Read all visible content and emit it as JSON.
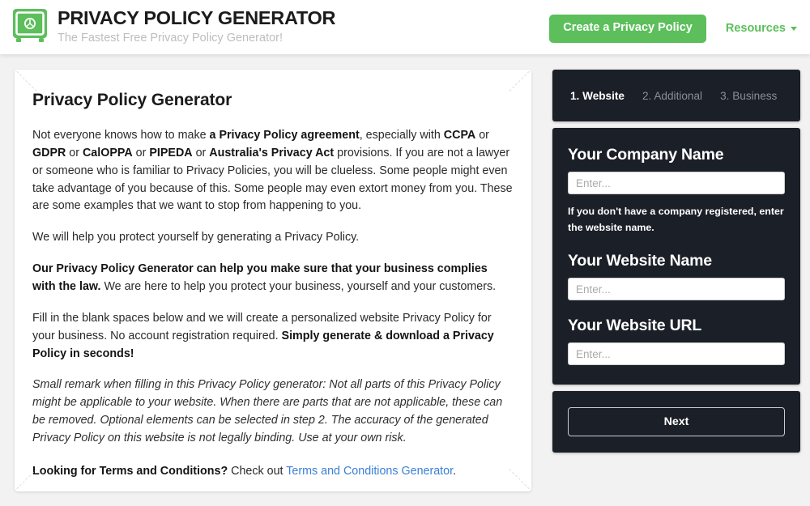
{
  "header": {
    "brand_title": "PRIVACY POLICY GENERATOR",
    "brand_tagline": "The Fastest Free Privacy Policy Generator!",
    "logo_icon": "safe-vault-icon",
    "cta_label": "Create a Privacy Policy",
    "nav_link_label": "Resources",
    "nav_caret_icon": "chevron-down-icon",
    "brand_color": "#5cbf5c"
  },
  "main": {
    "heading": "Privacy Policy Generator",
    "p1": {
      "a": "Not everyone knows how to make ",
      "b1": "a Privacy Policy agreement",
      "c": ", especially with ",
      "b2": "CCPA",
      "d": " or ",
      "b3": "GDPR",
      "e": " or ",
      "b4": "CalOPPA",
      "f": " or ",
      "b5": "PIPEDA",
      "g": " or ",
      "b6": "Australia's Privacy Act",
      "h": " provisions. If you are not a lawyer or someone who is familiar to Privacy Policies, you will be clueless. Some people might even take advantage of you because of this. Some people may even extort money from you. These are some examples that we want to stop from happening to you."
    },
    "p2": "We will help you protect yourself by generating a Privacy Policy.",
    "p3": {
      "bold": "Our Privacy Policy Generator can help you make sure that your business complies with the law.",
      "rest": " We are here to help you protect your business, yourself and your customers."
    },
    "p4": {
      "a": "Fill in the blank spaces below and we will create a personalized website Privacy Policy for your business. No account registration required. ",
      "bold": "Simply generate & download a Privacy Policy in seconds!"
    },
    "p5": "Small remark when filling in this Privacy Policy generator: Not all parts of this Privacy Policy might be applicable to your website. When there are parts that are not applicable, these can be removed. Optional elements can be selected in step 2. The accuracy of the generated Privacy Policy on this website is not legally binding. Use at your own risk.",
    "p6": {
      "bold": "Looking for Terms and Conditions?",
      "mid": " Check out ",
      "link": "Terms and Conditions Generator",
      "end": "."
    },
    "link_color": "#3a7fd5"
  },
  "wizard": {
    "tabs": [
      {
        "label": "1. Website",
        "active": true
      },
      {
        "label": "2. Additional",
        "active": false
      },
      {
        "label": "3. Business",
        "active": false
      }
    ],
    "fields": [
      {
        "label": "Your Company Name",
        "value": "",
        "placeholder": "Enter...",
        "hint": "If you don't have a company registered, enter the website name."
      },
      {
        "label": "Your Website Name",
        "value": "",
        "placeholder": "Enter...",
        "hint": ""
      },
      {
        "label": "Your Website URL",
        "value": "",
        "placeholder": "Enter...",
        "hint": ""
      }
    ],
    "next_label": "Next",
    "panel_color": "#1b1f27"
  }
}
